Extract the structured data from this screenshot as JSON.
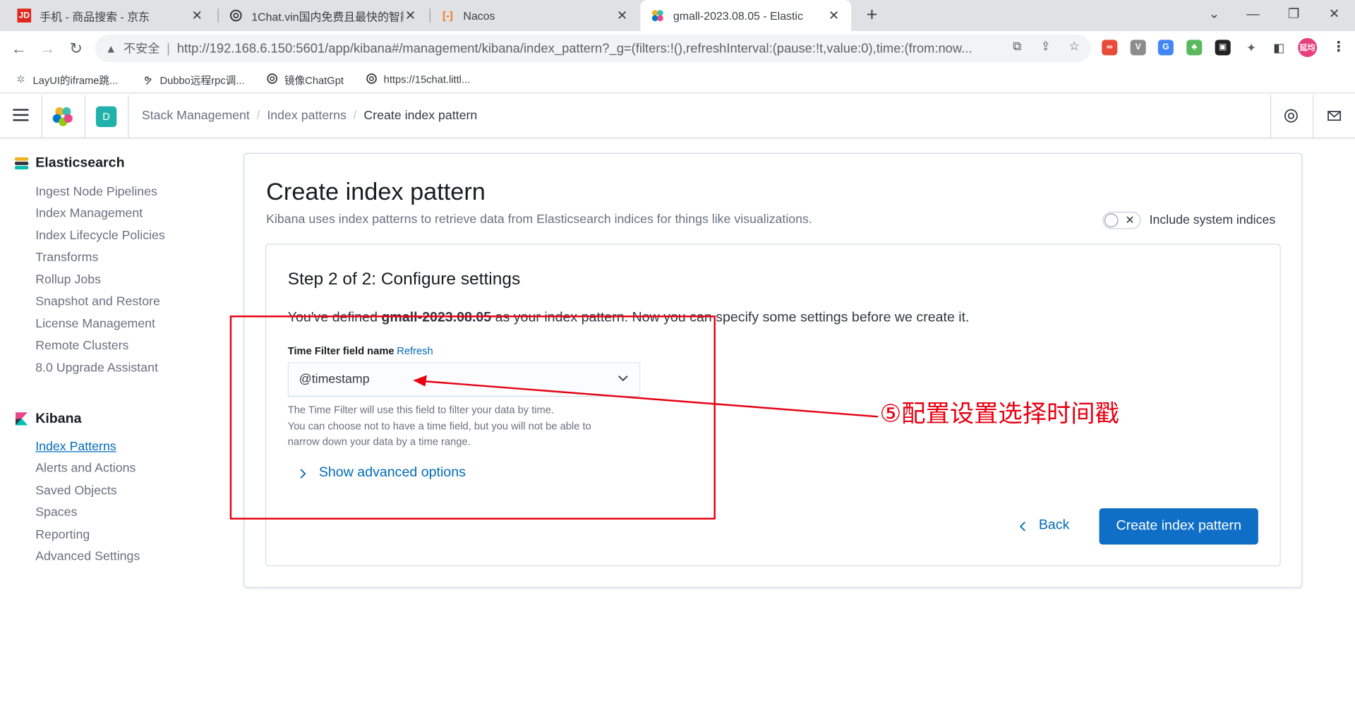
{
  "browser": {
    "tabs": [
      {
        "title": "手机 - 商品搜索 - 京东",
        "icon": "jd-icon"
      },
      {
        "title": "1Chat.vin国内免费且最快的智能",
        "icon": "openai-icon"
      },
      {
        "title": "Nacos",
        "icon": "nacos-icon"
      },
      {
        "title": "gmall-2023.08.05 - Elastic",
        "icon": "elastic-icon",
        "active": true
      }
    ],
    "security_label": "不安全",
    "url": "http://192.168.6.150:5601/app/kibana#/management/kibana/index_pattern?_g=(filters:!(),refreshInterval:(pause:!t,value:0),time:(from:now...",
    "profile_label": "延均",
    "bookmarks": [
      {
        "label": "LayUI的iframe跳...",
        "icon": "layui-icon"
      },
      {
        "label": "Dubbo远程rpc调...",
        "icon": "dubbo-icon"
      },
      {
        "label": "镜像ChatGpt",
        "icon": "openai-icon"
      },
      {
        "label": "https://15chat.littl...",
        "icon": "openai-icon"
      }
    ]
  },
  "kibana": {
    "space_letter": "D",
    "breadcrumbs": [
      "Stack Management",
      "Index patterns",
      "Create index pattern"
    ]
  },
  "sidenav": {
    "elasticsearch": {
      "title": "Elasticsearch",
      "items": [
        "Ingest Node Pipelines",
        "Index Management",
        "Index Lifecycle Policies",
        "Transforms",
        "Rollup Jobs",
        "Snapshot and Restore",
        "License Management",
        "Remote Clusters",
        "8.0 Upgrade Assistant"
      ]
    },
    "kibana": {
      "title": "Kibana",
      "items": [
        "Index Patterns",
        "Alerts and Actions",
        "Saved Objects",
        "Spaces",
        "Reporting",
        "Advanced Settings"
      ],
      "selected": "Index Patterns"
    }
  },
  "main": {
    "title": "Create index pattern",
    "description": "Kibana uses index patterns to retrieve data from Elasticsearch indices for things like visualizations.",
    "include_system_indices": "Include system indices",
    "step_title": "Step 2 of 2: Configure settings",
    "defined_prefix": "You've defined ",
    "defined_pattern": "gmall-2023.08.05",
    "defined_suffix": " as your index pattern. Now you can specify some settings before we create it.",
    "time_field_label": "Time Filter field name",
    "refresh_label": "Refresh",
    "time_field_value": "@timestamp",
    "help_line1": "The Time Filter will use this field to filter your data by time.",
    "help_line2": "You can choose not to have a time field, but you will not be able to",
    "help_line3": "narrow down your data by a time range.",
    "advanced_label": "Show advanced options",
    "back_label": "Back",
    "create_label": "Create index pattern"
  },
  "annotation": {
    "text": "⑤配置设置选择时间戳",
    "color": "#e60012"
  }
}
